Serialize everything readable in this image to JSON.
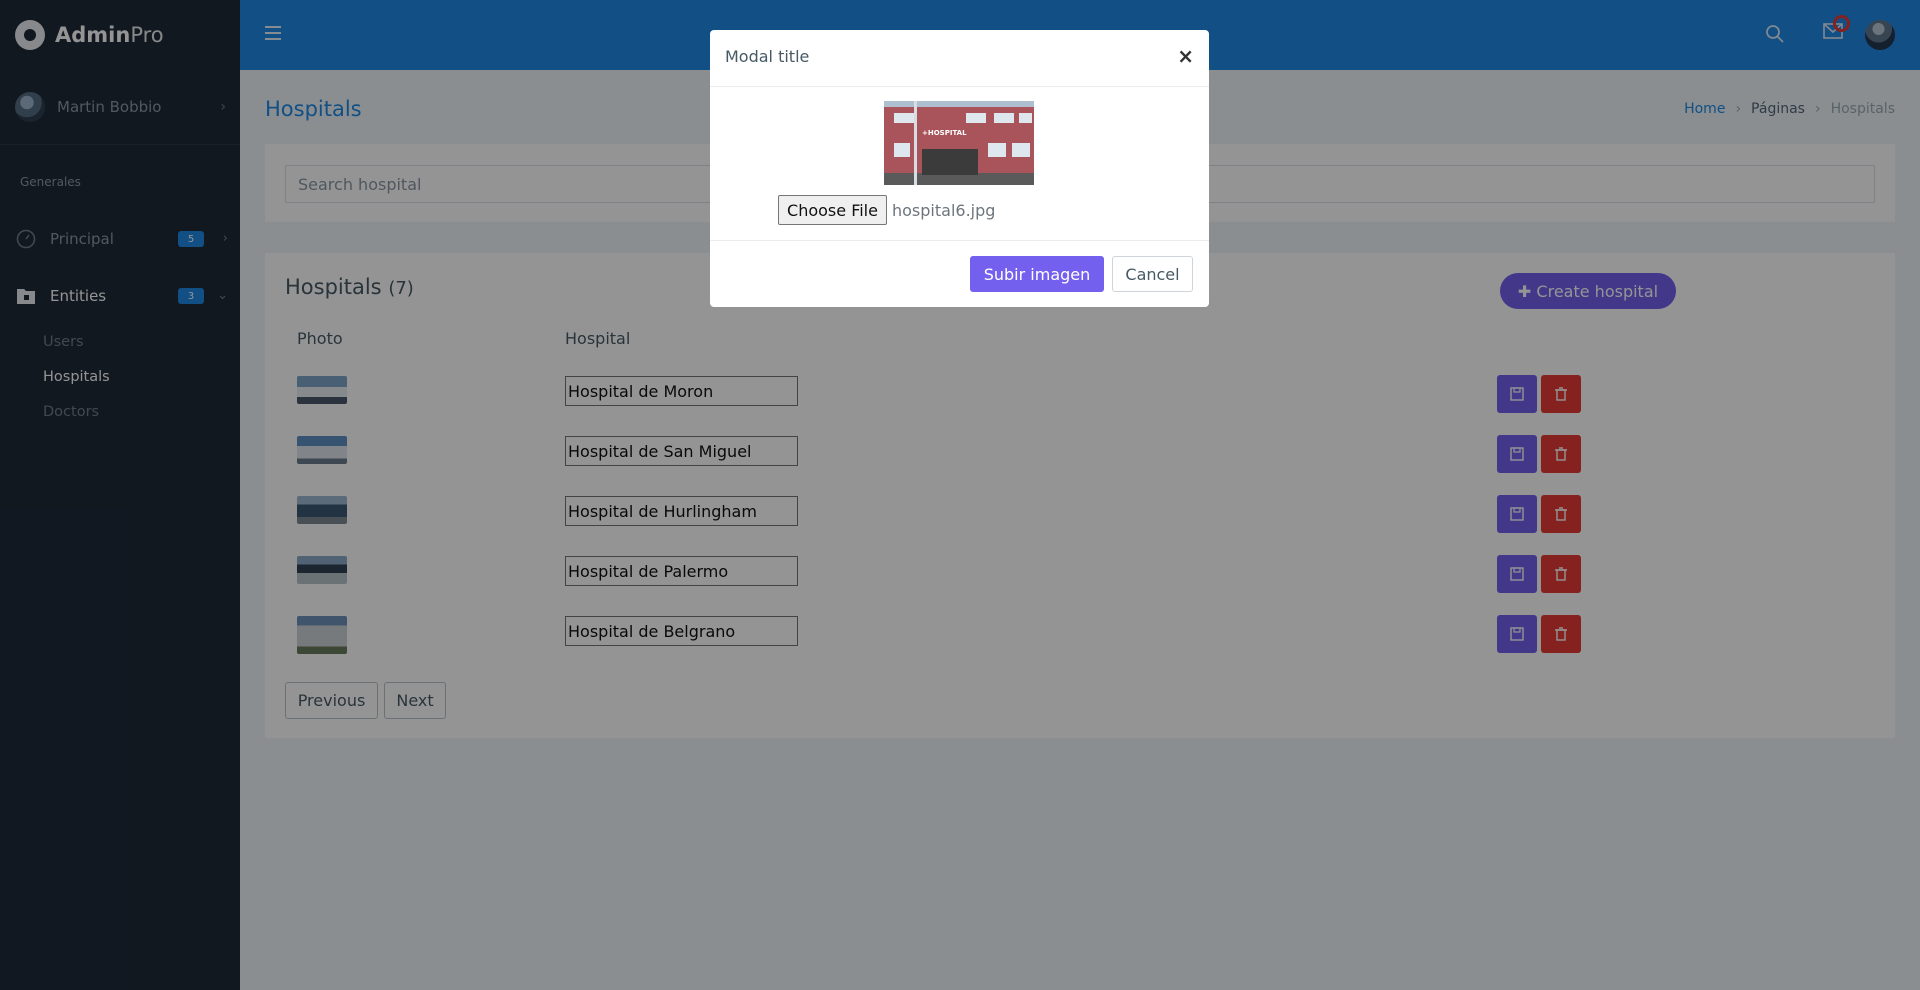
{
  "app": {
    "logo_bold": "Admin",
    "logo_light": "Pro"
  },
  "user": {
    "name": "Martin Bobbio"
  },
  "sidebar": {
    "caption": "Generales",
    "items": [
      {
        "label": "Principal",
        "badge": "5",
        "icon": "gauge-icon"
      },
      {
        "label": "Entities",
        "badge": "3",
        "icon": "folder-lock-icon"
      }
    ],
    "subitems": [
      "Users",
      "Hospitals",
      "Doctors"
    ]
  },
  "page": {
    "title": "Hospitals",
    "breadcrumb": [
      "Home",
      "Páginas",
      "Hospitals"
    ]
  },
  "search": {
    "placeholder": "Search hospital"
  },
  "list": {
    "title": "Hospitals",
    "count": "(7)",
    "create_label": "Create hospital",
    "col_photo": "Photo",
    "col_hospital": "Hospital",
    "rows": [
      {
        "name": "Hospital de Moron"
      },
      {
        "name": "Hospital de San Miguel"
      },
      {
        "name": "Hospital de Hurlingham"
      },
      {
        "name": "Hospital de Palermo"
      },
      {
        "name": "Hospital de Belgrano"
      }
    ],
    "prev_label": "Previous",
    "next_label": "Next"
  },
  "modal": {
    "title": "Modal title",
    "close": "×",
    "preview_sign": "+HOSPITAL",
    "file_button": "Choose File",
    "file_name": "hospital6.jpg",
    "upload_label": "Subir imagen",
    "cancel_label": "Cancel"
  },
  "colors": {
    "primary": "#1e88e5",
    "purple": "#7460ee",
    "danger": "#e53935",
    "sidebar": "#1e2a38"
  }
}
